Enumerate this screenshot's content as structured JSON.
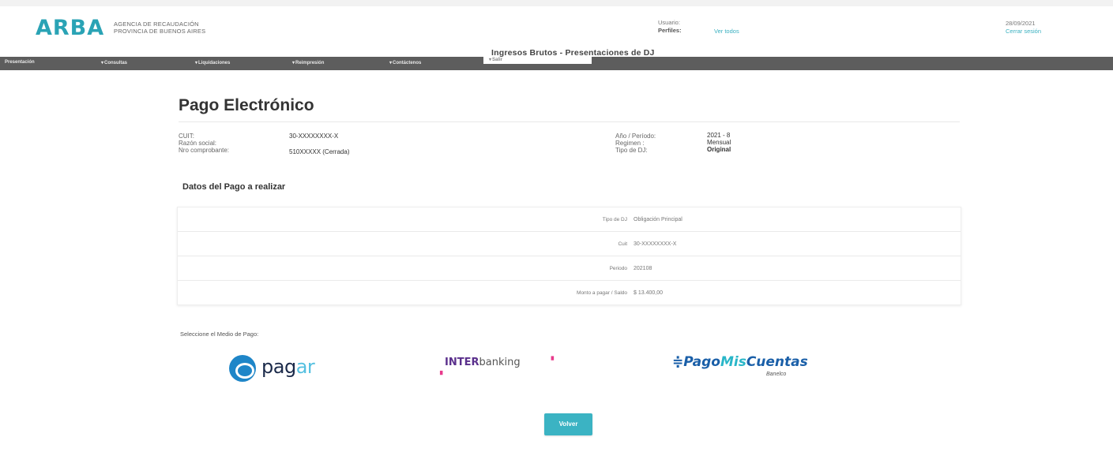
{
  "header": {
    "logo": "ARBA",
    "agency_line1": "AGENCIA DE RECAUDACIÓN",
    "agency_line2": "PROVINCIA DE BUENOS AIRES",
    "user_label": "Usuario:",
    "profiles_label": "Perfiles:",
    "profiles_link": "Ver todos",
    "date": "28/09/2021",
    "logout": "Cerrar sesión"
  },
  "system_title": "Ingresos Brutos - Presentaciones de DJ",
  "menu": [
    {
      "label": "Presentación",
      "caret": false
    },
    {
      "label": "Consultas",
      "caret": true
    },
    {
      "label": "Liquidaciones",
      "caret": true
    },
    {
      "label": "Reimpresión",
      "caret": true
    },
    {
      "label": "Contáctenos",
      "caret": true
    },
    {
      "label": "Salir",
      "caret": true
    }
  ],
  "page_title": "Pago Electrónico",
  "info": {
    "cuit_label": "CUIT:",
    "cuit_value": "30-XXXXXXXX-X",
    "razon_label": "Razón social:",
    "razon_value": "",
    "nro_label": "Nro comprobante:",
    "nro_value": "510XXXXX (Cerrada)",
    "anio_label": "Año / Período:",
    "anio_value": "2021 - 8",
    "regimen_label": "Regimen :",
    "regimen_value": "Mensual",
    "tipo_label": "Tipo de DJ:",
    "tipo_value": "Original"
  },
  "section_title": "Datos del Pago a realizar",
  "payment_rows": [
    {
      "key": "Tipo de DJ",
      "value": "Obligación Principal"
    },
    {
      "key": "Cuit",
      "value": "30-XXXXXXXX-X"
    },
    {
      "key": "Periodo",
      "value": "202108"
    },
    {
      "key": "Monto a pagar / Saldo",
      "value": "$ 13.400,00"
    }
  ],
  "select_label": "Seleccione el Medio de Pago:",
  "payment_methods": {
    "pagar_a": "pag",
    "pagar_b": "ar",
    "inter_bold": "INTER",
    "inter_rest": "banking",
    "pmc_a": "Pago",
    "pmc_b": "Mis",
    "pmc_c": "Cuentas",
    "pmc_sub": "Banelco"
  },
  "back_button": "Volver",
  "colors": {
    "accent": "#3bb3c3",
    "menu_bar": "#5d5d5d",
    "logo": "#2aa3b5"
  }
}
